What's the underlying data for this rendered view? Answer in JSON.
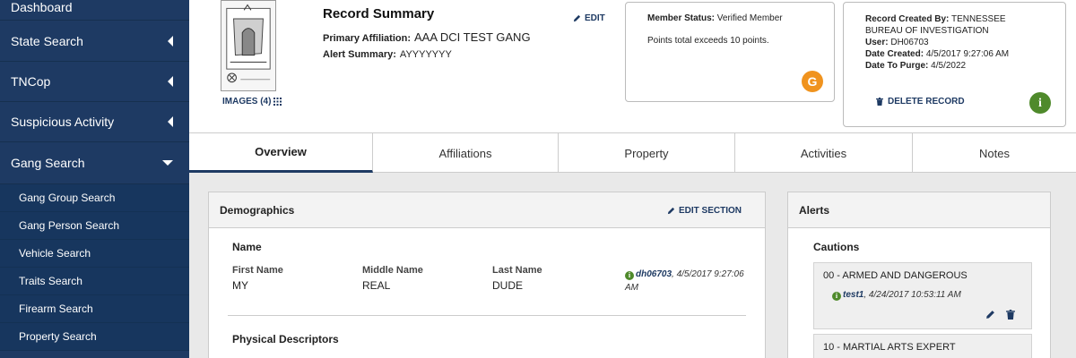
{
  "sidebar": {
    "top_items": [
      {
        "label": "Dashboard"
      },
      {
        "label": "State Search"
      },
      {
        "label": "TNCop"
      },
      {
        "label": "Suspicious Activity"
      },
      {
        "label": "Gang Search"
      }
    ],
    "sub_items": [
      {
        "label": "Gang Group Search"
      },
      {
        "label": "Gang Person Search"
      },
      {
        "label": "Vehicle Search"
      },
      {
        "label": "Traits Search"
      },
      {
        "label": "Firearm Search"
      },
      {
        "label": "Property Search"
      }
    ]
  },
  "header": {
    "images_label": "IMAGES (4)",
    "title": "Record Summary",
    "primary_affiliation_label": "Primary Affiliation:",
    "primary_affiliation_value": "AAA DCI TEST GANG",
    "alert_summary_label": "Alert Summary:",
    "alert_summary_value": "AYYYYYYY",
    "edit_label": "EDIT"
  },
  "status_card": {
    "member_status_label": "Member Status:",
    "member_status_value": "Verified Member",
    "points_text": "Points total exceeds 10 points.",
    "badge": "G"
  },
  "record_card": {
    "created_by_label": "Record Created By:",
    "created_by_value": "TENNESSEE BUREAU OF INVESTIGATION",
    "user_label": "User:",
    "user_value": "DH06703",
    "date_created_label": "Date Created:",
    "date_created_value": "4/5/2017 9:27:06 AM",
    "date_purge_label": "Date To Purge:",
    "date_purge_value": "4/5/2022",
    "delete_label": "DELETE RECORD",
    "info_badge": "i"
  },
  "tabs": [
    {
      "label": "Overview"
    },
    {
      "label": "Affiliations"
    },
    {
      "label": "Property"
    },
    {
      "label": "Activities"
    },
    {
      "label": "Notes"
    }
  ],
  "demographics": {
    "title": "Demographics",
    "edit_section_label": "EDIT SECTION",
    "name_section": "Name",
    "first_name_label": "First Name",
    "first_name_value": "MY",
    "middle_name_label": "Middle Name",
    "middle_name_value": "REAL",
    "last_name_label": "Last Name",
    "last_name_value": "DUDE",
    "audit_user": "dh06703",
    "audit_date": ", 4/5/2017 9:27:06 AM",
    "physical_section": "Physical Descriptors"
  },
  "alerts": {
    "title": "Alerts",
    "cautions_label": "Cautions",
    "items": [
      {
        "title": "00 - ARMED AND DANGEROUS",
        "user": "test1",
        "date": ", 4/24/2017 10:53:11 AM"
      },
      {
        "title": "10 - MARTIAL ARTS EXPERT"
      }
    ]
  },
  "colors": {
    "sidebar": "#1e3a63",
    "accent": "#1e3a63",
    "badge_orange": "#f0931e",
    "badge_green": "#4f8a2b"
  }
}
